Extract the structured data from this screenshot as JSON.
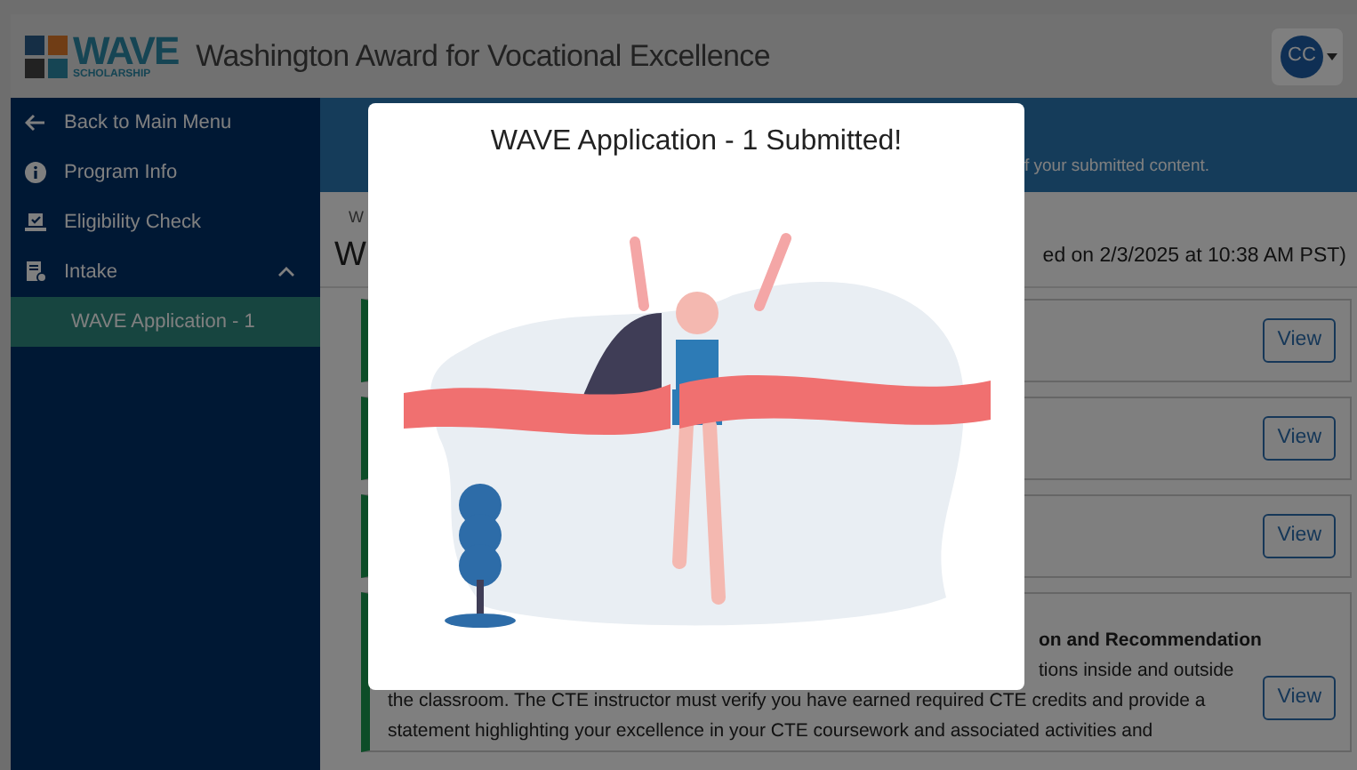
{
  "header": {
    "logo_text": "WAVE",
    "logo_subtext": "SCHOLARSHIP",
    "title": "Washington Award for Vocational Excellence",
    "avatar": "CC"
  },
  "sidebar": {
    "items": [
      {
        "kind": "back",
        "label": "Back to Main Menu",
        "selected": false
      },
      {
        "kind": "info",
        "label": "Program Info",
        "selected": false
      },
      {
        "kind": "check",
        "label": "Eligibility Check",
        "selected": false
      },
      {
        "kind": "intake",
        "label": "Intake",
        "selected": false,
        "expanded": true,
        "children": [
          {
            "label": "WAVE Application - 1",
            "selected": true
          }
        ]
      }
    ]
  },
  "main": {
    "banner_text": "f your submitted content.",
    "breadcrumb": "W",
    "heading": "W",
    "submitted_note": "ed on 2/3/2025 at 10:38 AM PST)",
    "cards": [
      {
        "button": "View"
      },
      {
        "button": "View"
      },
      {
        "button": "View"
      },
      {
        "title": "on and Recommendation",
        "lines": [
          "tions inside and outside",
          "the classroom. The CTE instructor must verify you have earned required CTE credits and provide a",
          "statement highlighting your excellence in your CTE coursework and associated activities and"
        ],
        "button": "View"
      }
    ]
  },
  "modal": {
    "title": "WAVE Application - 1 Submitted!"
  }
}
